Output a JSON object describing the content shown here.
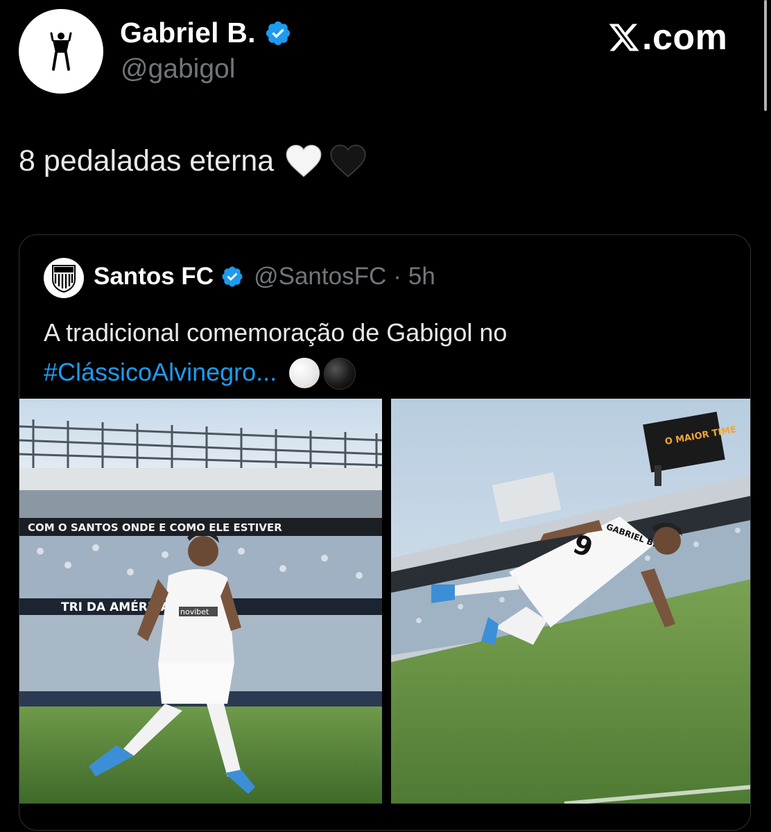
{
  "author": {
    "name": "Gabriel B.",
    "handle": "@gabigol",
    "verified_color": "#1d9bf0"
  },
  "brand": {
    "domain": ".com",
    "logo": "x-logo-icon"
  },
  "tweet": {
    "text": "8 pedaladas eterna",
    "emojis": [
      "white-heart-icon",
      "black-heart-icon"
    ]
  },
  "quote": {
    "name": "Santos FC",
    "handle": "@SantosFC",
    "separator": "·",
    "time": "5h",
    "text": "A tradicional comemoração de Gabigol no",
    "hashtag": "#ClássicoAlvinegro...",
    "emojis": [
      "white-circle-icon",
      "black-circle-icon"
    ],
    "photo_left_text": {
      "banner_top": "COM O SANTOS ONDE E COMO ELE ESTIVER",
      "banner_mid": "TRI DA AMÉRICA",
      "shirt_sponsor": "novibet"
    },
    "photo_right_text": {
      "shirt_name": "GABRIEL B.",
      "shirt_number": "9",
      "scoreboard": "O MAIOR TIME"
    }
  },
  "colors": {
    "background": "#000000",
    "text": "#e7e9ea",
    "muted": "#71767b",
    "link": "#1d9bf0",
    "border": "#2f3336"
  }
}
